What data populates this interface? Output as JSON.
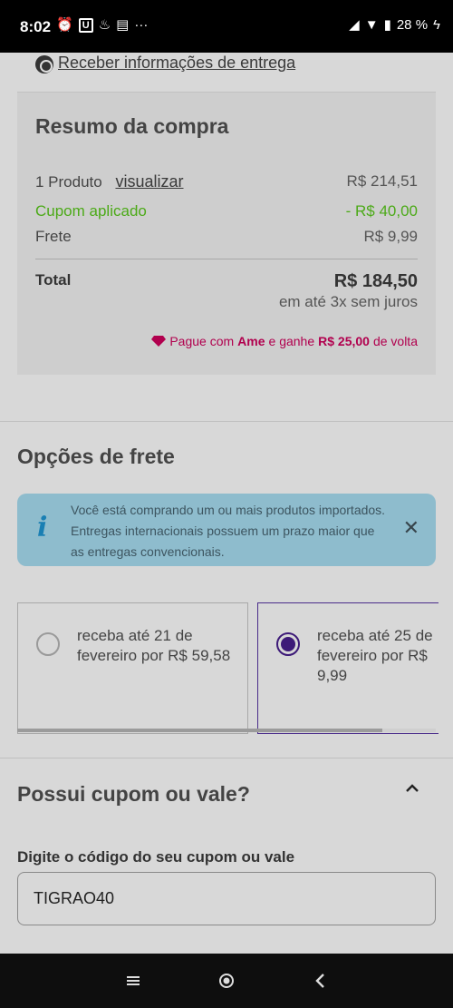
{
  "status_bar": {
    "time": "8:02",
    "battery": "28 %"
  },
  "summary": {
    "delivery_link": "Receber informações de entrega",
    "title": "Resumo da compra",
    "product_label": "1 Produto",
    "view_link": "visualizar",
    "product_value": "R$ 214,51",
    "coupon_label": "Cupom aplicado",
    "coupon_value": "- R$ 40,00",
    "shipping_label": "Frete",
    "shipping_value": "R$ 9,99",
    "total_label": "Total",
    "total_value": "R$ 184,50",
    "installments": "em até 3x sem juros",
    "ame_prefix": "Pague com",
    "ame_brand": "Ame",
    "ame_middle": "e ganhe",
    "ame_amount": "R$ 25,00",
    "ame_suffix": "de volta"
  },
  "shipping_options": {
    "title": "Opções de frete",
    "info_text": "Você está comprando um ou mais produtos importados. Entregas internacionais possuem um prazo maior que as entregas convencionais.",
    "info_icon": "i",
    "close_icon": "✕",
    "options": [
      {
        "text": "receba até 21 de fevereiro por R$ 59,58",
        "selected": false
      },
      {
        "text": "receba até 25 de fevereiro por R$ 9,99",
        "selected": true
      }
    ]
  },
  "coupon": {
    "title": "Possui cupom ou vale?",
    "field_label": "Digite o código do seu cupom ou vale",
    "field_value": "TIGRAO40"
  },
  "colors": {
    "accent_purple": "#3d1a78",
    "green": "#4caa18",
    "ame_pink": "#b1004e",
    "info_bg": "#8ebccd"
  }
}
